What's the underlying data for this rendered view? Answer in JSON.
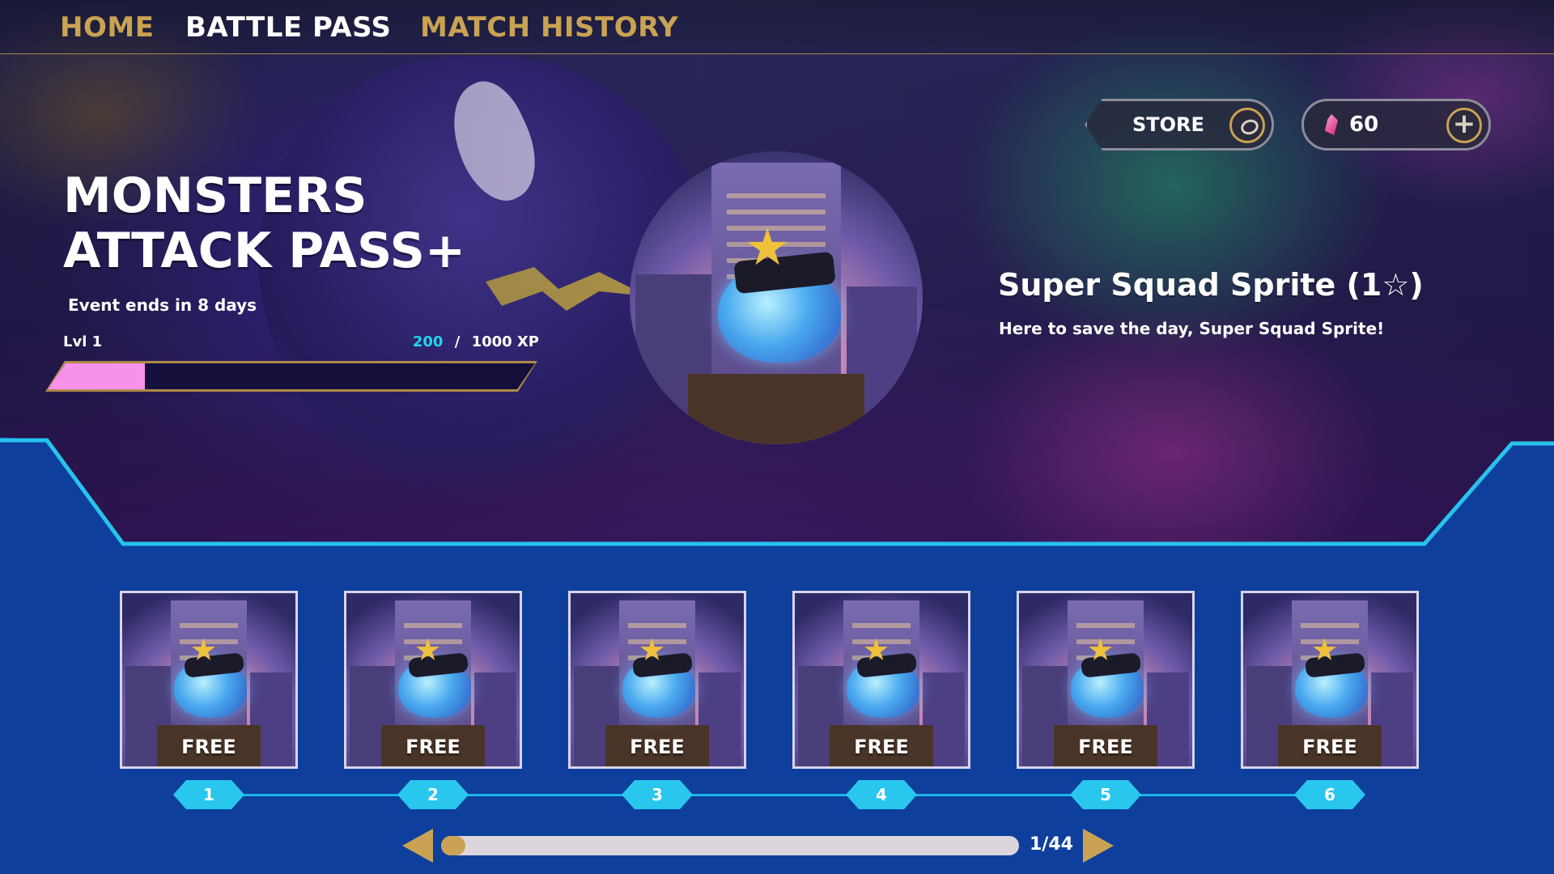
{
  "nav": {
    "items": [
      {
        "label": "HOME",
        "active": false
      },
      {
        "label": "BATTLE PASS",
        "active": true
      },
      {
        "label": "MATCH HISTORY",
        "active": false
      }
    ]
  },
  "top_right": {
    "store_label": "STORE",
    "store_icon": "store-egg-icon",
    "currency_icon": "gem-icon",
    "currency_amount": "60",
    "add_icon": "plus-icon"
  },
  "pass": {
    "title": "MONSTERS ATTACK PASS+",
    "event_ends": "Event ends in 8 days",
    "level": "Lvl 1",
    "xp_current": "200",
    "xp_separator": "/",
    "xp_total": "1000 XP",
    "xp_fraction": 0.2
  },
  "featured_reward": {
    "name": "Super Squad Sprite (1☆)",
    "description": "Here to save the day, Super Squad Sprite!"
  },
  "track": {
    "rewards": [
      {
        "level": "1",
        "label": "FREE"
      },
      {
        "level": "2",
        "label": "FREE"
      },
      {
        "level": "3",
        "label": "FREE"
      },
      {
        "level": "4",
        "label": "FREE"
      },
      {
        "level": "5",
        "label": "FREE"
      },
      {
        "level": "6",
        "label": "FREE"
      }
    ]
  },
  "pagination": {
    "page_label": "1/44",
    "position_fraction": 0.0
  },
  "colors": {
    "accent_gold": "#c9a253",
    "panel_blue": "#0e3f9c",
    "frame_cyan": "#27c3ec",
    "xp_pink": "#f692ea",
    "xp_cyan_text": "#24d4ee"
  }
}
